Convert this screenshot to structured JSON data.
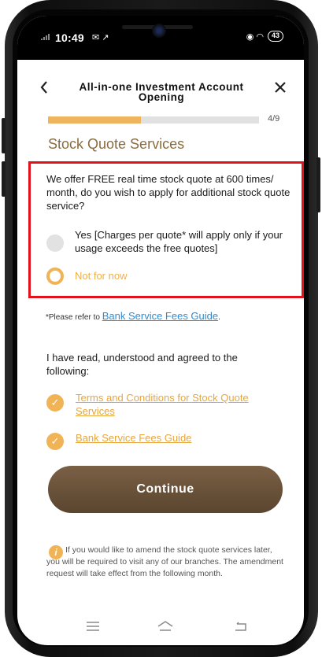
{
  "status": {
    "time": "10:49",
    "left_icons": "✉ ↗",
    "right_icons": "◉ ◠",
    "battery": "43"
  },
  "header": {
    "back_icon": "chevron-left-icon",
    "title": "All-in-one Investment Account Opening",
    "close_icon": "close-icon"
  },
  "progress": {
    "fraction": 0.44,
    "label": "4/9"
  },
  "section_title": "Stock Quote Services",
  "question": "We offer FREE real time stock quote at 600 times/ month, do you wish to apply for additional stock quote service?",
  "options": [
    {
      "label": "Yes [Charges per quote* will apply only if your usage exceeds the free quotes]",
      "selected": false
    },
    {
      "label": "Not for now",
      "selected": true
    }
  ],
  "refer": {
    "prefix": "*Please refer to",
    "link": "Bank Service Fees Guide",
    "suffix": "."
  },
  "agreement": {
    "text": "I have read, understood and agreed to the following:",
    "items": [
      {
        "label": "Terms and Conditions for Stock Quote Services",
        "checked": true
      },
      {
        "label": "Bank Service Fees Guide",
        "checked": true
      }
    ]
  },
  "continue_label": "Continue",
  "info": {
    "icon": "i",
    "text": "If you would like to amend the stock quote services later, you will be required to visit any of our branches. The amendment request will take effect from the following month."
  },
  "colors": {
    "accent": "#f0b356",
    "brand_title": "#8a6c3f",
    "button": "#6b5139",
    "highlight": "#e0121b",
    "link_blue": "#2d8bd4"
  }
}
